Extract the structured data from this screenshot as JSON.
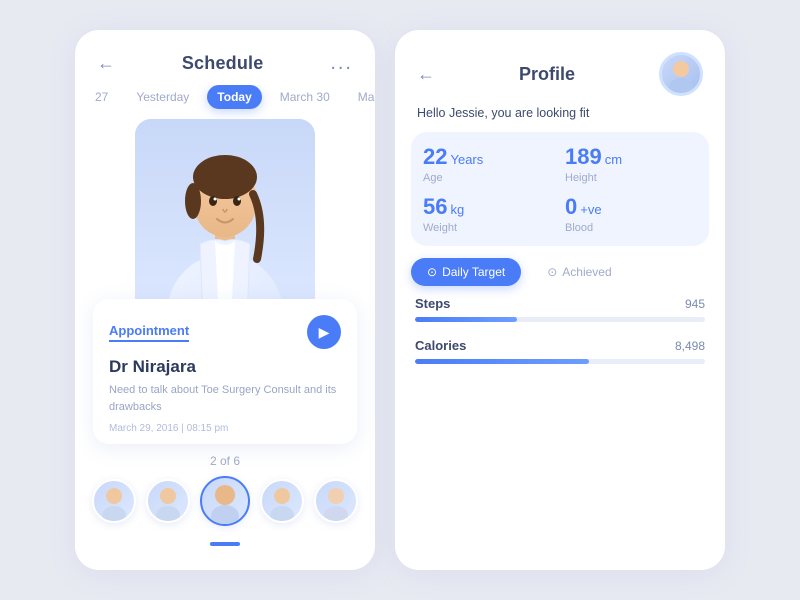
{
  "schedule": {
    "title": "Schedule",
    "back_label": "←",
    "more_label": "...",
    "dates": [
      {
        "label": "27",
        "active": false
      },
      {
        "label": "Yesterday",
        "active": false
      },
      {
        "label": "Today",
        "active": true
      },
      {
        "label": "March 30",
        "active": false
      },
      {
        "label": "Mar",
        "active": false
      }
    ],
    "appointment": {
      "label": "Appointment",
      "doctor_name": "Dr Nirajara",
      "description": "Need to talk about Toe Surgery Consult and its drawbacks",
      "date": "March 29, 2016  |  08:15 pm",
      "icon": "▶"
    },
    "pagination": "2 of 6",
    "avatars": [
      {
        "id": 1,
        "active": false
      },
      {
        "id": 2,
        "active": false
      },
      {
        "id": 3,
        "active": true
      },
      {
        "id": 4,
        "active": false
      },
      {
        "id": 5,
        "active": false
      }
    ]
  },
  "profile": {
    "title": "Profile",
    "back_label": "←",
    "greeting": "Hello Jessie, you are looking fit",
    "stats": [
      {
        "value": "22",
        "unit": "Years",
        "label": "Age"
      },
      {
        "value": "189",
        "unit": "cm",
        "label": "Height"
      },
      {
        "value": "56",
        "unit": "kg",
        "label": "Weight"
      },
      {
        "value": "0",
        "unit": "+ve",
        "label": "Blood"
      }
    ],
    "tabs": [
      {
        "label": "Daily Target",
        "active": true,
        "icon": "⊙"
      },
      {
        "label": "Achieved",
        "active": false,
        "icon": "⊙"
      }
    ],
    "progress_items": [
      {
        "label": "Steps",
        "value": "945",
        "percent": 35
      },
      {
        "label": "Calories",
        "value": "8,498",
        "percent": 60
      }
    ]
  },
  "colors": {
    "accent": "#4a7cf7",
    "text_primary": "#2d3a5e",
    "text_secondary": "#a0aacb",
    "bg_card": "#ffffff",
    "bg_page": "#e8eaf2"
  }
}
